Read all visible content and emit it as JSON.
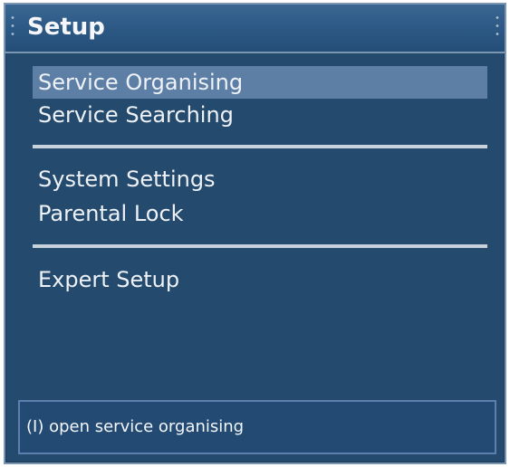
{
  "window": {
    "title": "Setup"
  },
  "menu": {
    "items": [
      {
        "label": "Service Organising",
        "selected": true
      },
      {
        "label": "Service Searching",
        "selected": false
      },
      {
        "label": "System Settings",
        "selected": false
      },
      {
        "label": "Parental Lock",
        "selected": false
      },
      {
        "label": "Expert Setup",
        "selected": false
      }
    ]
  },
  "status": {
    "help_text": "(I) open service organising"
  },
  "colors": {
    "background": "#244a6e",
    "selection": "#5d7fa5",
    "text": "#eef2f7"
  }
}
